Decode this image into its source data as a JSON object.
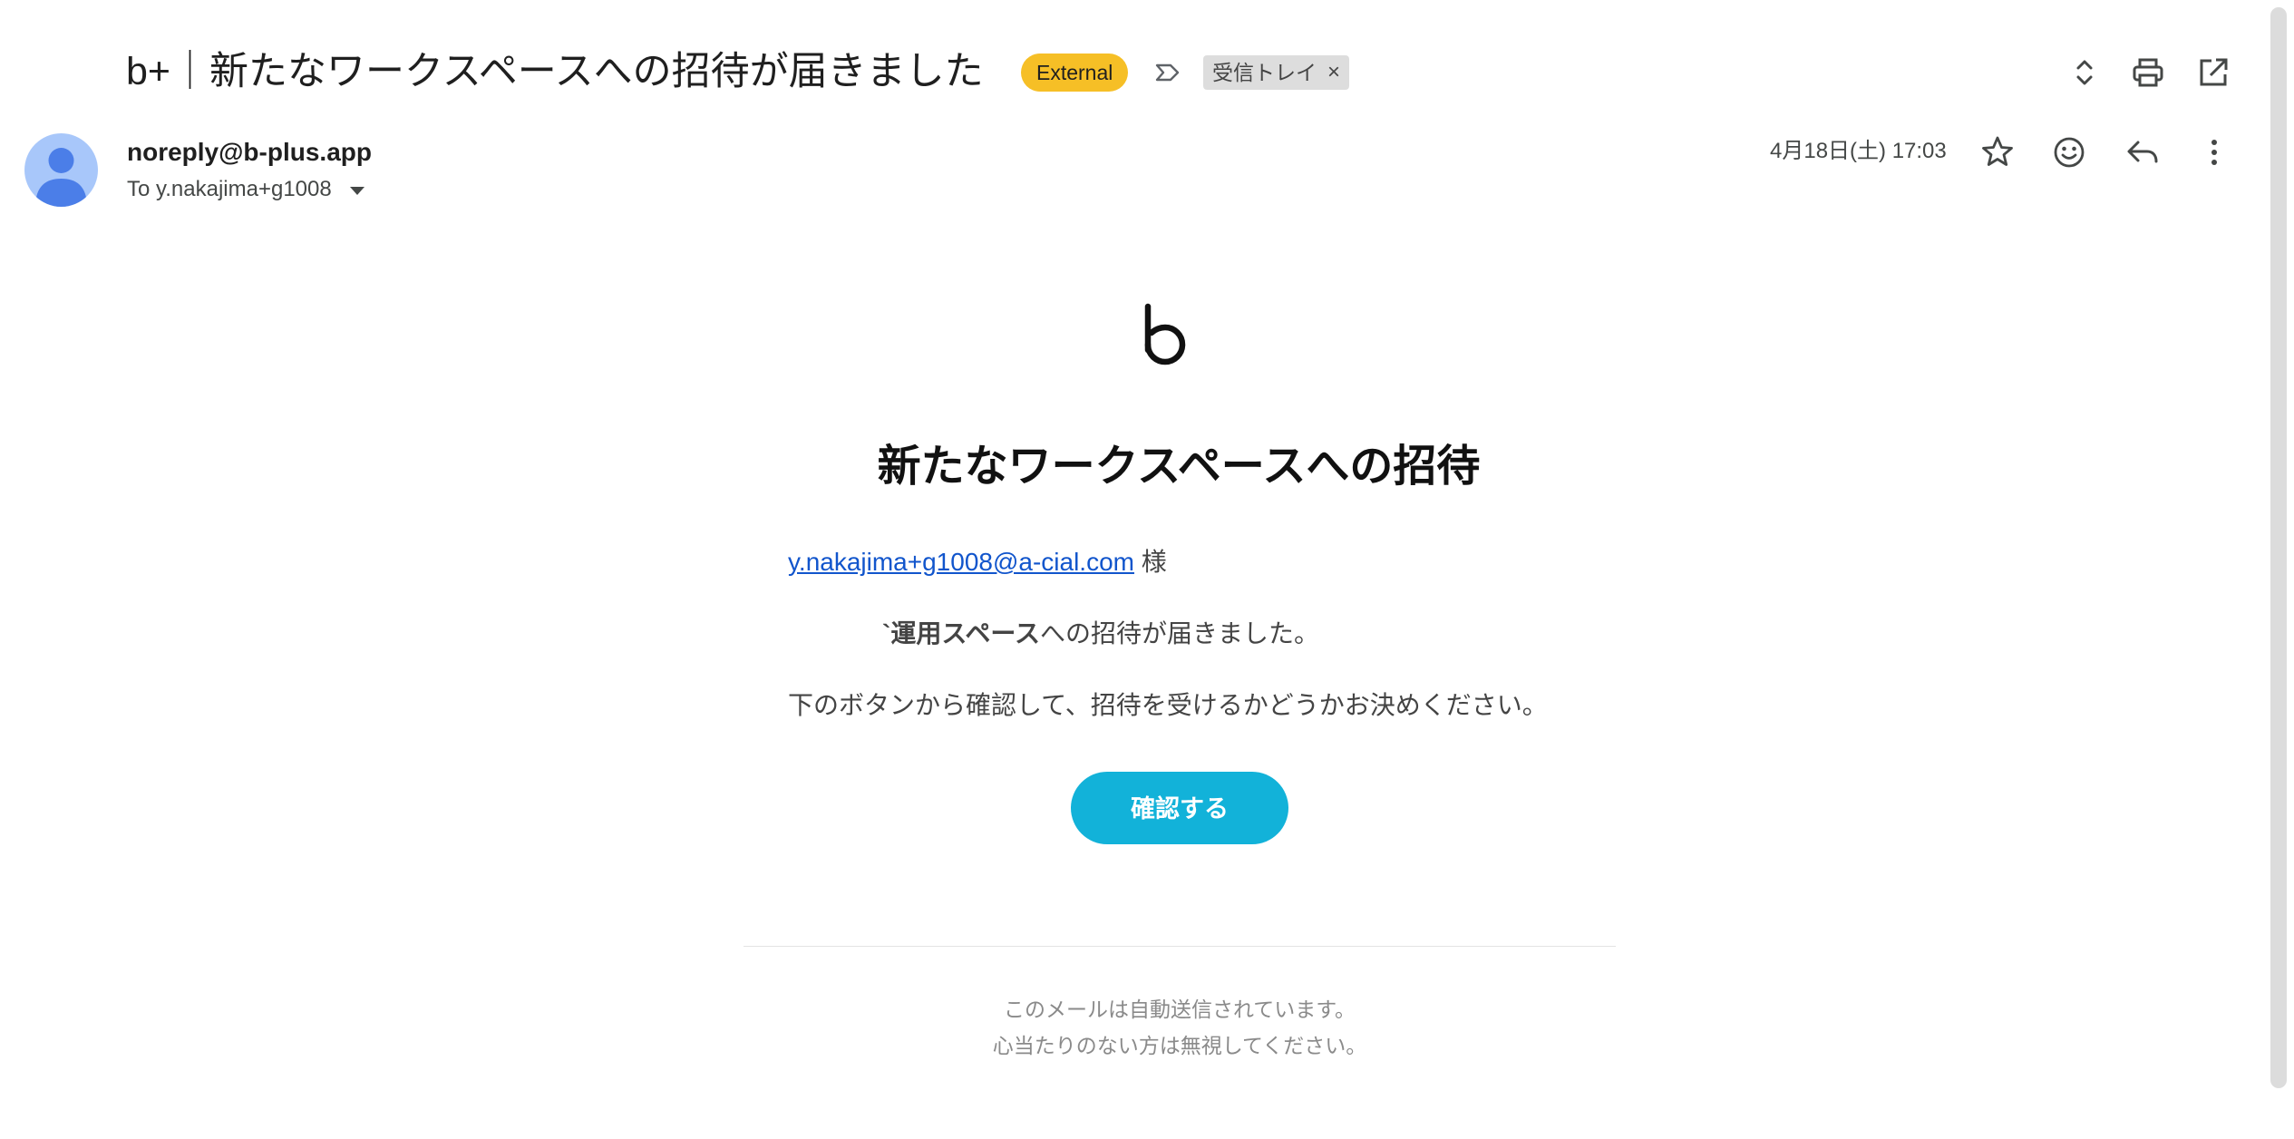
{
  "header": {
    "subject": "b+｜新たなワークスペースへの招待が届きました",
    "external_badge": "External",
    "label_chip": "受信トレイ",
    "label_remove": "×"
  },
  "sender": {
    "from": "noreply@b-plus.app",
    "to": "To y.nakajima+g1008",
    "date": "4月18日(土) 17:03"
  },
  "email": {
    "title": "新たなワークスペースへの招待",
    "recipient_email": "y.nakajima+g1008@a-cial.com",
    "recipient_suffix": " 様",
    "workspace_prefix": "`",
    "workspace_name": "運用スペース",
    "invite_text": "への招待が届きました。",
    "instructions": "下のボタンから確認して、招待を受けるかどうかお決めください。",
    "button_label": "確認する",
    "footer_line1": "このメールは自動送信されています。",
    "footer_line2": "心当たりのない方は無視してください。"
  },
  "colors": {
    "external_badge": "#f6bf26",
    "button": "#12b2d9",
    "link": "#1155cc",
    "avatar": "#a8c7fa"
  },
  "icons": {
    "header": [
      "expand-collapse-icon",
      "print-icon",
      "open-in-new-window-icon"
    ],
    "row": [
      "star-icon",
      "emoji-reaction-icon",
      "reply-icon",
      "more-vert-icon"
    ],
    "importance": "importance-marker-icon"
  }
}
